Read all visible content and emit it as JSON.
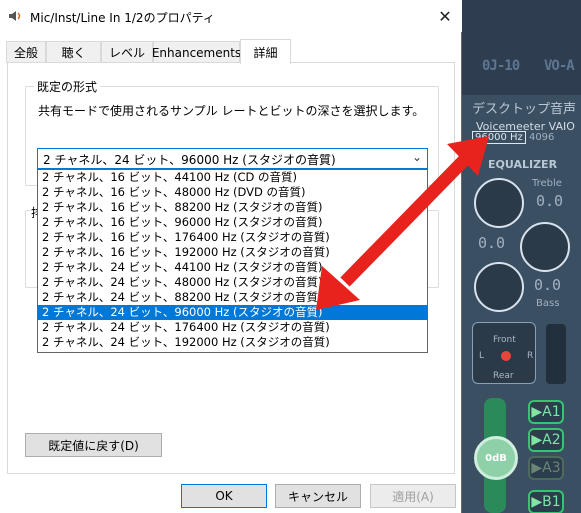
{
  "window": {
    "title": "Mic/Inst/Line In 1/2のプロパティ",
    "close_glyph": "✕"
  },
  "tabs": [
    {
      "label": "全般"
    },
    {
      "label": "聴く"
    },
    {
      "label": "レベル"
    },
    {
      "label": "Enhancements"
    },
    {
      "label": "詳細"
    }
  ],
  "default_format": {
    "group_label": "既定の形式",
    "description": "共有モードで使用されるサンプル レートとビットの深さを選択します。",
    "selected": "2 チャネル、24 ビット、96000 Hz (スタジオの音質)",
    "options": [
      "2 チャネル、16 ビット、44100 Hz (CD の音質)",
      "2 チャネル、16 ビット、48000 Hz (DVD の音質)",
      "2 チャネル、16 ビット、88200 Hz (スタジオの音質)",
      "2 チャネル、16 ビット、96000 Hz (スタジオの音質)",
      "2 チャネル、16 ビット、176400 Hz (スタジオの音質)",
      "2 チャネル、16 ビット、192000 Hz (スタジオの音質)",
      "2 チャネル、24 ビット、44100 Hz (スタジオの音質)",
      "2 チャネル、24 ビット、48000 Hz (スタジオの音質)",
      "2 チャネル、24 ビット、88200 Hz (スタジオの音質)",
      "2 チャネル、24 ビット、96000 Hz (スタジオの音質)",
      "2 チャネル、24 ビット、176400 Hz (スタジオの音質)",
      "2 チャネル、24 ビット、192000 Hz (スタジオの音質)"
    ],
    "selected_index": 9
  },
  "hidden_group_fragment": "排",
  "buttons": {
    "restore_defaults": "既定値に戻す(D)",
    "ok": "OK",
    "cancel": "キャンセル",
    "apply": "適用(A)"
  },
  "voicemeeter": {
    "logo_left": "0J-10",
    "logo_right": "VO-A",
    "strip_title": "デスクトップ音声",
    "device_name": "Voicemeeter VAIO",
    "sample_rate": "96000 Hz",
    "buffer": "4096",
    "eq_label": "EQUALIZER",
    "treble_label": "Treble",
    "treble_value": "0.0",
    "mid_value": "0.0",
    "bass_value": "0.0",
    "bass_label": "Bass",
    "pan_front": "Front",
    "pan_rear": "Rear",
    "pan_left": "L",
    "pan_right": "R",
    "fader_value": "0dB",
    "buses": [
      "▶A1",
      "▶A2",
      "▶A3",
      "▶B1"
    ]
  },
  "colors": {
    "accent": "#0078d7",
    "arrow": "#e8231d",
    "vm_bg": "#3b4f63",
    "bus_green": "#37c470"
  }
}
